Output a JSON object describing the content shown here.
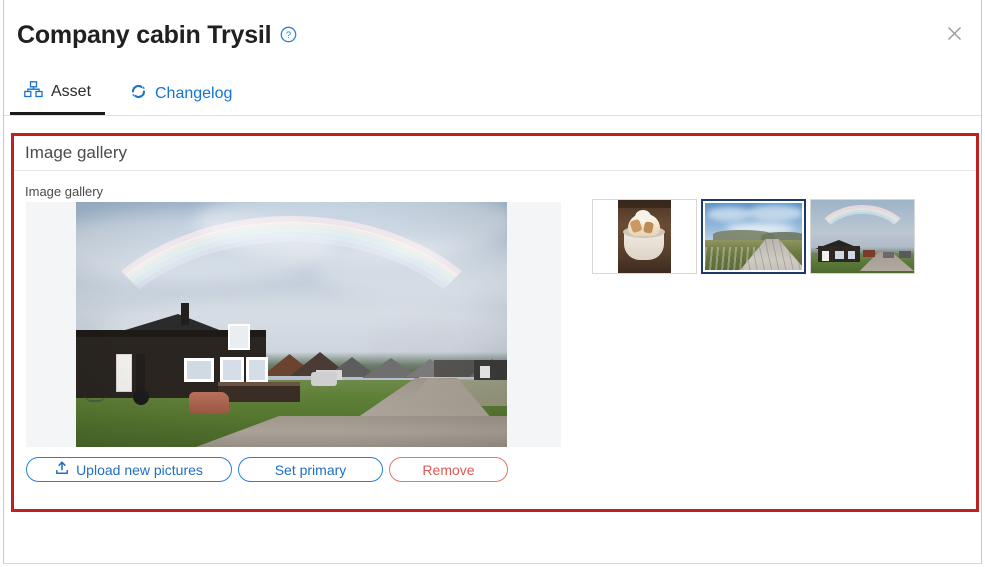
{
  "window": {
    "title": "Company cabin Trysil",
    "help_icon": "help-circle-icon",
    "close_icon": "close-icon"
  },
  "tabs": [
    {
      "label": "Asset",
      "icon": "org-chart-icon",
      "active": true
    },
    {
      "label": "Changelog",
      "icon": "sync-arrows-icon",
      "active": false
    }
  ],
  "panel": {
    "header_title": "Image gallery",
    "field_label": "Image gallery",
    "highlight_color": "#c0201f"
  },
  "gallery": {
    "main_image_alt": "Black wooden cabin under a full rainbow on a gravel road in Trysil",
    "thumbnails": [
      {
        "alt": "Bowl of ice cream dessert on a wooden table",
        "selected": false,
        "orientation": "portrait"
      },
      {
        "alt": "Wooden boardwalk path across green tundra under blue sky",
        "selected": true,
        "orientation": "landscape"
      },
      {
        "alt": "Black cabin with full rainbow over gravel road",
        "selected": false,
        "orientation": "landscape"
      }
    ]
  },
  "actions": {
    "upload": {
      "label": "Upload new pictures",
      "icon": "upload-icon",
      "color": "#1e6fc4"
    },
    "set_primary": {
      "label": "Set primary",
      "color": "#1e6fc4"
    },
    "remove": {
      "label": "Remove",
      "color": "#e0574d"
    }
  }
}
